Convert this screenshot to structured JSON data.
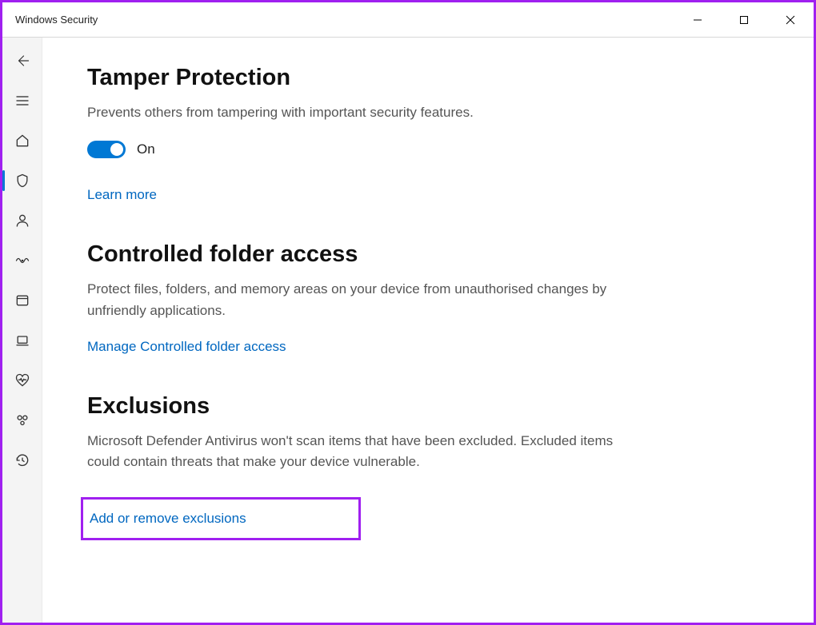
{
  "window": {
    "title": "Windows Security"
  },
  "sidebar": {
    "items": [
      {
        "id": "back",
        "icon": "back-arrow",
        "selected": false
      },
      {
        "id": "menu",
        "icon": "hamburger",
        "selected": false
      },
      {
        "id": "home",
        "icon": "home",
        "selected": false
      },
      {
        "id": "virus",
        "icon": "shield",
        "selected": true
      },
      {
        "id": "account",
        "icon": "person",
        "selected": false
      },
      {
        "id": "firewall",
        "icon": "network",
        "selected": false
      },
      {
        "id": "appbrowser",
        "icon": "app-window",
        "selected": false
      },
      {
        "id": "device",
        "icon": "laptop",
        "selected": false
      },
      {
        "id": "performance",
        "icon": "heart",
        "selected": false
      },
      {
        "id": "family",
        "icon": "family",
        "selected": false
      },
      {
        "id": "history",
        "icon": "history",
        "selected": false
      }
    ]
  },
  "sections": {
    "tamper": {
      "heading": "Tamper Protection",
      "description": "Prevents others from tampering with important security features.",
      "toggle_state": "On",
      "learn_more": "Learn more"
    },
    "cfa": {
      "heading": "Controlled folder access",
      "description": "Protect files, folders, and memory areas on your device from unauthorised changes by unfriendly applications.",
      "manage_link": "Manage Controlled folder access"
    },
    "exclusions": {
      "heading": "Exclusions",
      "description": "Microsoft Defender Antivirus won't scan items that have been excluded. Excluded items could contain threats that make your device vulnerable.",
      "add_remove_link": "Add or remove exclusions"
    }
  }
}
